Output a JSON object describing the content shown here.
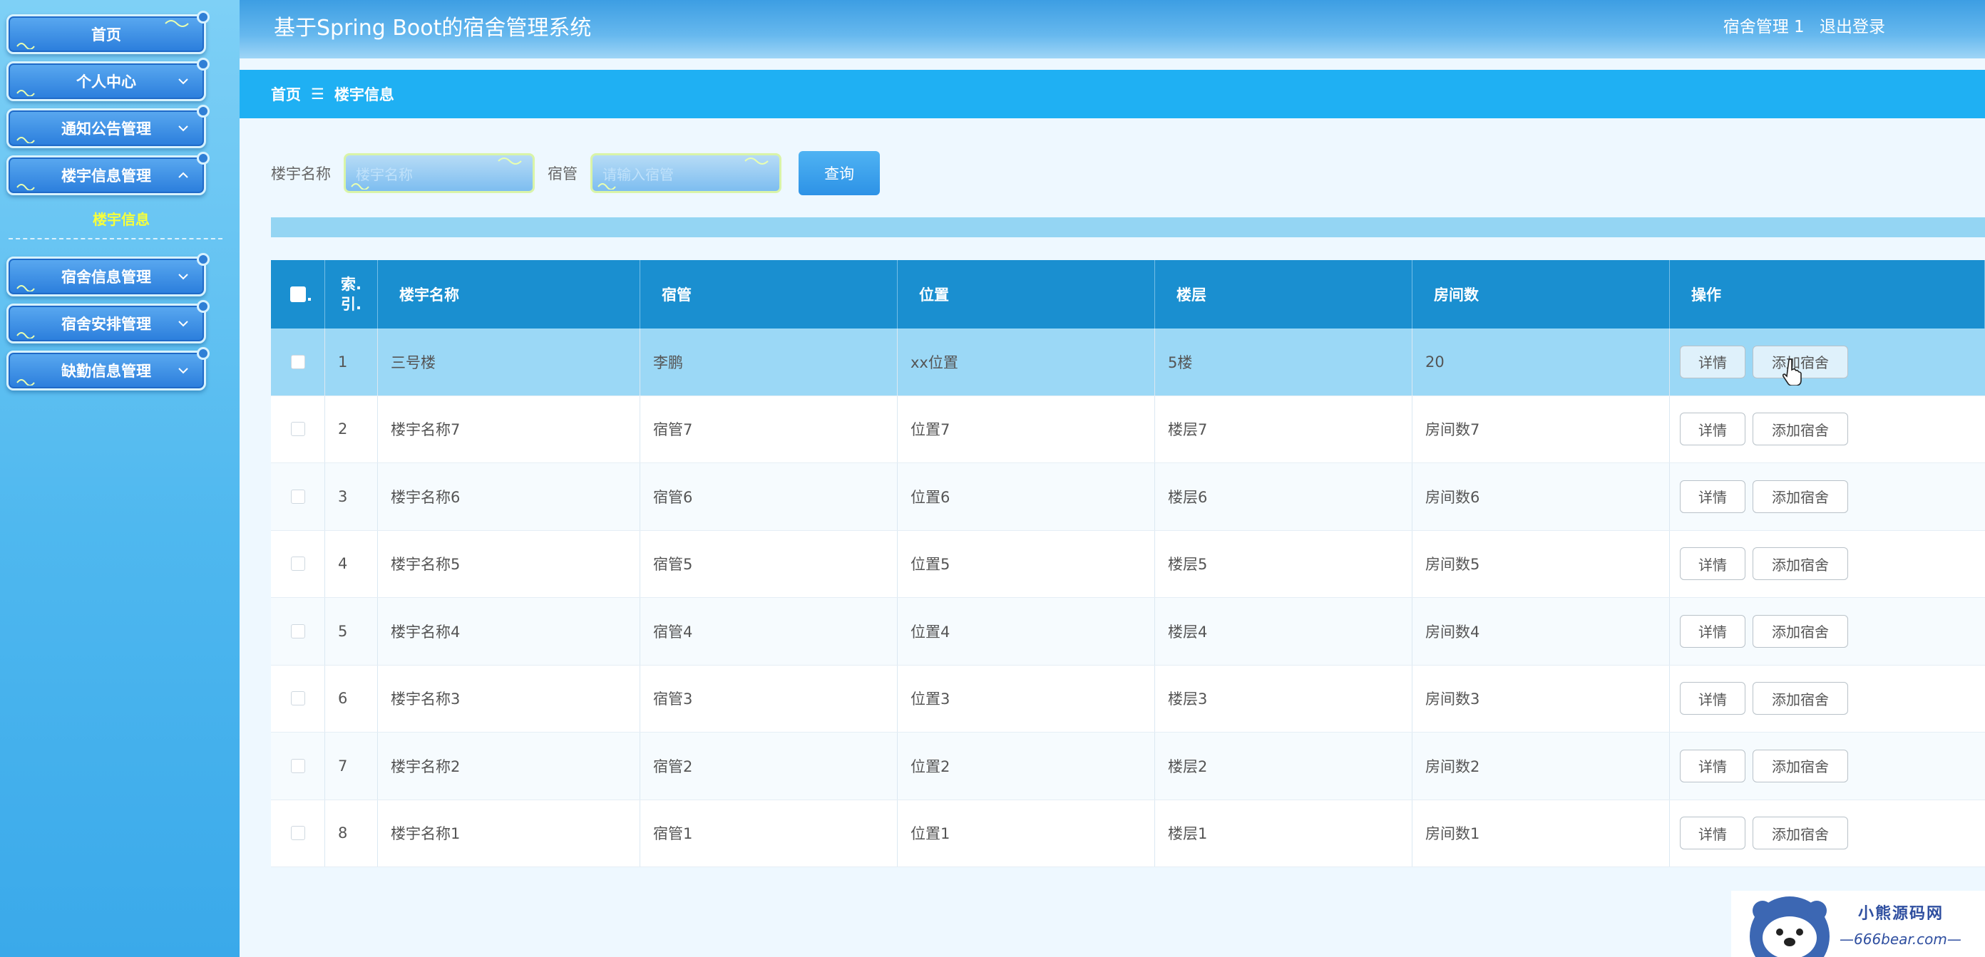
{
  "app": {
    "title": "基于Spring Boot的宿舍管理系统",
    "user": "宿舍管理 1",
    "logout": "退出登录"
  },
  "sidebar": {
    "items": [
      {
        "label": "首页"
      },
      {
        "label": "个人中心"
      },
      {
        "label": "通知公告管理"
      },
      {
        "label": "楼宇信息管理"
      },
      {
        "label": "宿舍信息管理"
      },
      {
        "label": "宿舍安排管理"
      },
      {
        "label": "缺勤信息管理"
      }
    ],
    "sub_active": "楼宇信息"
  },
  "breadcrumb": {
    "home": "首页",
    "sep": "☰",
    "current": "楼宇信息"
  },
  "search": {
    "name_label": "楼宇名称",
    "name_placeholder": "楼宇名称",
    "manager_label": "宿管",
    "manager_placeholder": "请输入宿管",
    "query_btn": "查询"
  },
  "table": {
    "headers": [
      "索引",
      "楼宇名称",
      "宿管",
      "位置",
      "楼层",
      "房间数",
      "操作"
    ],
    "index_header_line1": "索.",
    "index_header_line2": "引.",
    "detail_btn": "详情",
    "add_btn": "添加宿舍",
    "rows": [
      {
        "index": "1",
        "name": "三号楼",
        "manager": "李鹏",
        "location": "xx位置",
        "floor": "5楼",
        "rooms": "20"
      },
      {
        "index": "2",
        "name": "楼宇名称7",
        "manager": "宿管7",
        "location": "位置7",
        "floor": "楼层7",
        "rooms": "房间数7"
      },
      {
        "index": "3",
        "name": "楼宇名称6",
        "manager": "宿管6",
        "location": "位置6",
        "floor": "楼层6",
        "rooms": "房间数6"
      },
      {
        "index": "4",
        "name": "楼宇名称5",
        "manager": "宿管5",
        "location": "位置5",
        "floor": "楼层5",
        "rooms": "房间数5"
      },
      {
        "index": "5",
        "name": "楼宇名称4",
        "manager": "宿管4",
        "location": "位置4",
        "floor": "楼层4",
        "rooms": "房间数4"
      },
      {
        "index": "6",
        "name": "楼宇名称3",
        "manager": "宿管3",
        "location": "位置3",
        "floor": "楼层3",
        "rooms": "房间数3"
      },
      {
        "index": "7",
        "name": "楼宇名称2",
        "manager": "宿管2",
        "location": "位置2",
        "floor": "楼层2",
        "rooms": "房间数2"
      },
      {
        "index": "8",
        "name": "楼宇名称1",
        "manager": "宿管1",
        "location": "位置1",
        "floor": "楼层1",
        "rooms": "房间数1"
      }
    ]
  },
  "watermark": {
    "line1": "小熊源码网",
    "line2": "—666bear.com—"
  },
  "colors": {
    "accent": "#1fb0f3",
    "table_header": "#1a8fd0",
    "selected_row": "#9bd8f6",
    "sub_menu_text": "#f7ff3a"
  }
}
